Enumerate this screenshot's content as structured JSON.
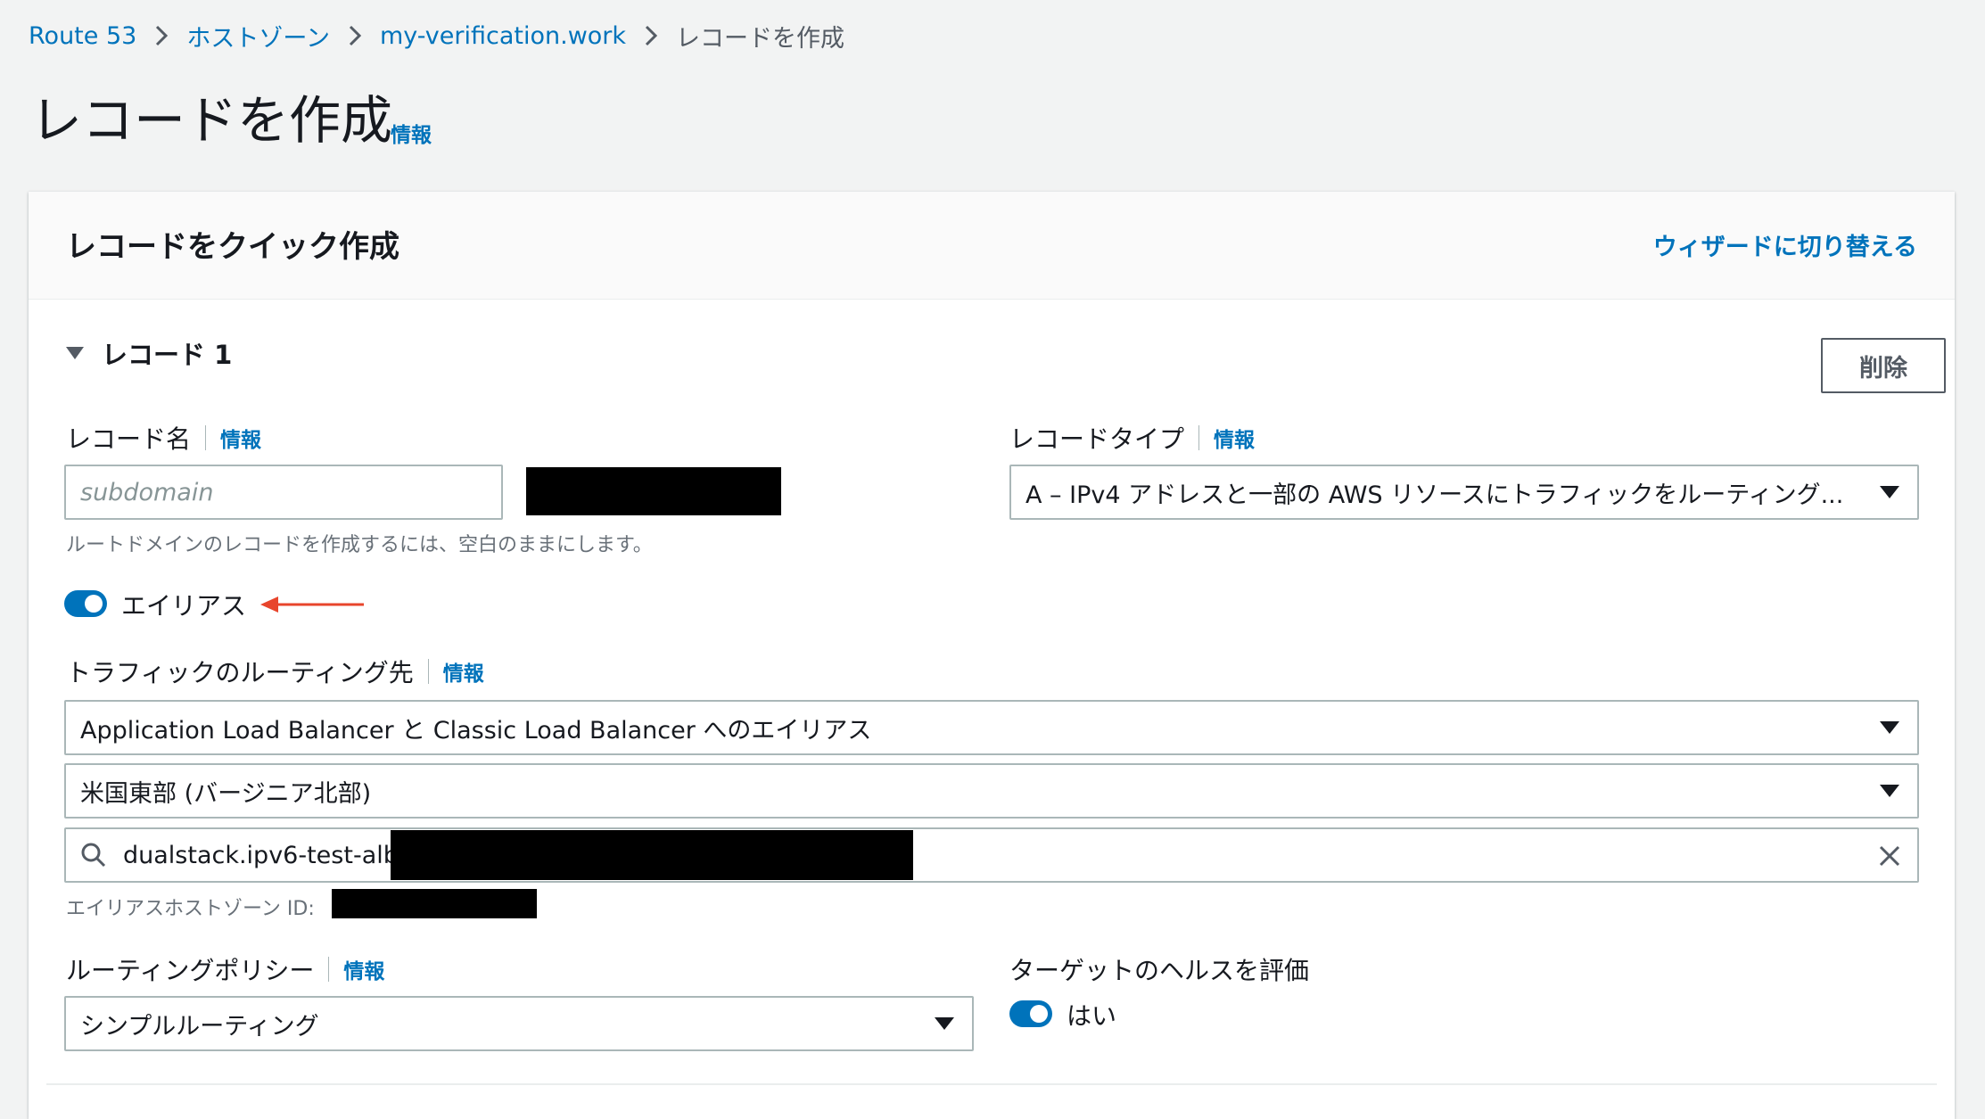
{
  "breadcrumb": {
    "items": [
      "Route 53",
      "ホストゾーン",
      "my-verification.work",
      "レコードを作成"
    ]
  },
  "page": {
    "title": "レコードを作成",
    "info_label": "情報"
  },
  "card": {
    "title": "レコードをクイック作成",
    "wizard_link": "ウィザードに切り替える"
  },
  "record": {
    "section_label": "レコード 1",
    "delete_label": "削除",
    "name": {
      "label": "レコード名",
      "info": "情報",
      "placeholder": "subdomain",
      "hint": "ルートドメインのレコードを作成するには、空白のままにします。"
    },
    "type": {
      "label": "レコードタイプ",
      "info": "情報",
      "value": "A – IPv4 アドレスと一部の AWS リソースにトラフィックをルーティング..."
    },
    "alias": {
      "label": "エイリアス",
      "enabled": true
    },
    "routing_target": {
      "label": "トラフィックのルーティング先",
      "info": "情報",
      "endpoint_value": "Application Load Balancer と Classic Load Balancer へのエイリアス",
      "region_value": "米国東部 (バージニア北部)",
      "search_value": "dualstack.ipv6-test-alb-",
      "hosted_zone_label": "エイリアスホストゾーン ID:"
    },
    "routing_policy": {
      "label": "ルーティングポリシー",
      "info": "情報",
      "value": "シンプルルーティング"
    },
    "health": {
      "label": "ターゲットのヘルスを評価",
      "toggle_label": "はい",
      "enabled": true
    }
  },
  "colors": {
    "link": "#0073bb",
    "toggle_on": "#0073bb",
    "annotation_arrow": "#e8452c"
  },
  "icons": [
    "chevron-right-icon",
    "caret-down-icon",
    "search-icon",
    "close-icon",
    "red-arrow-icon"
  ]
}
